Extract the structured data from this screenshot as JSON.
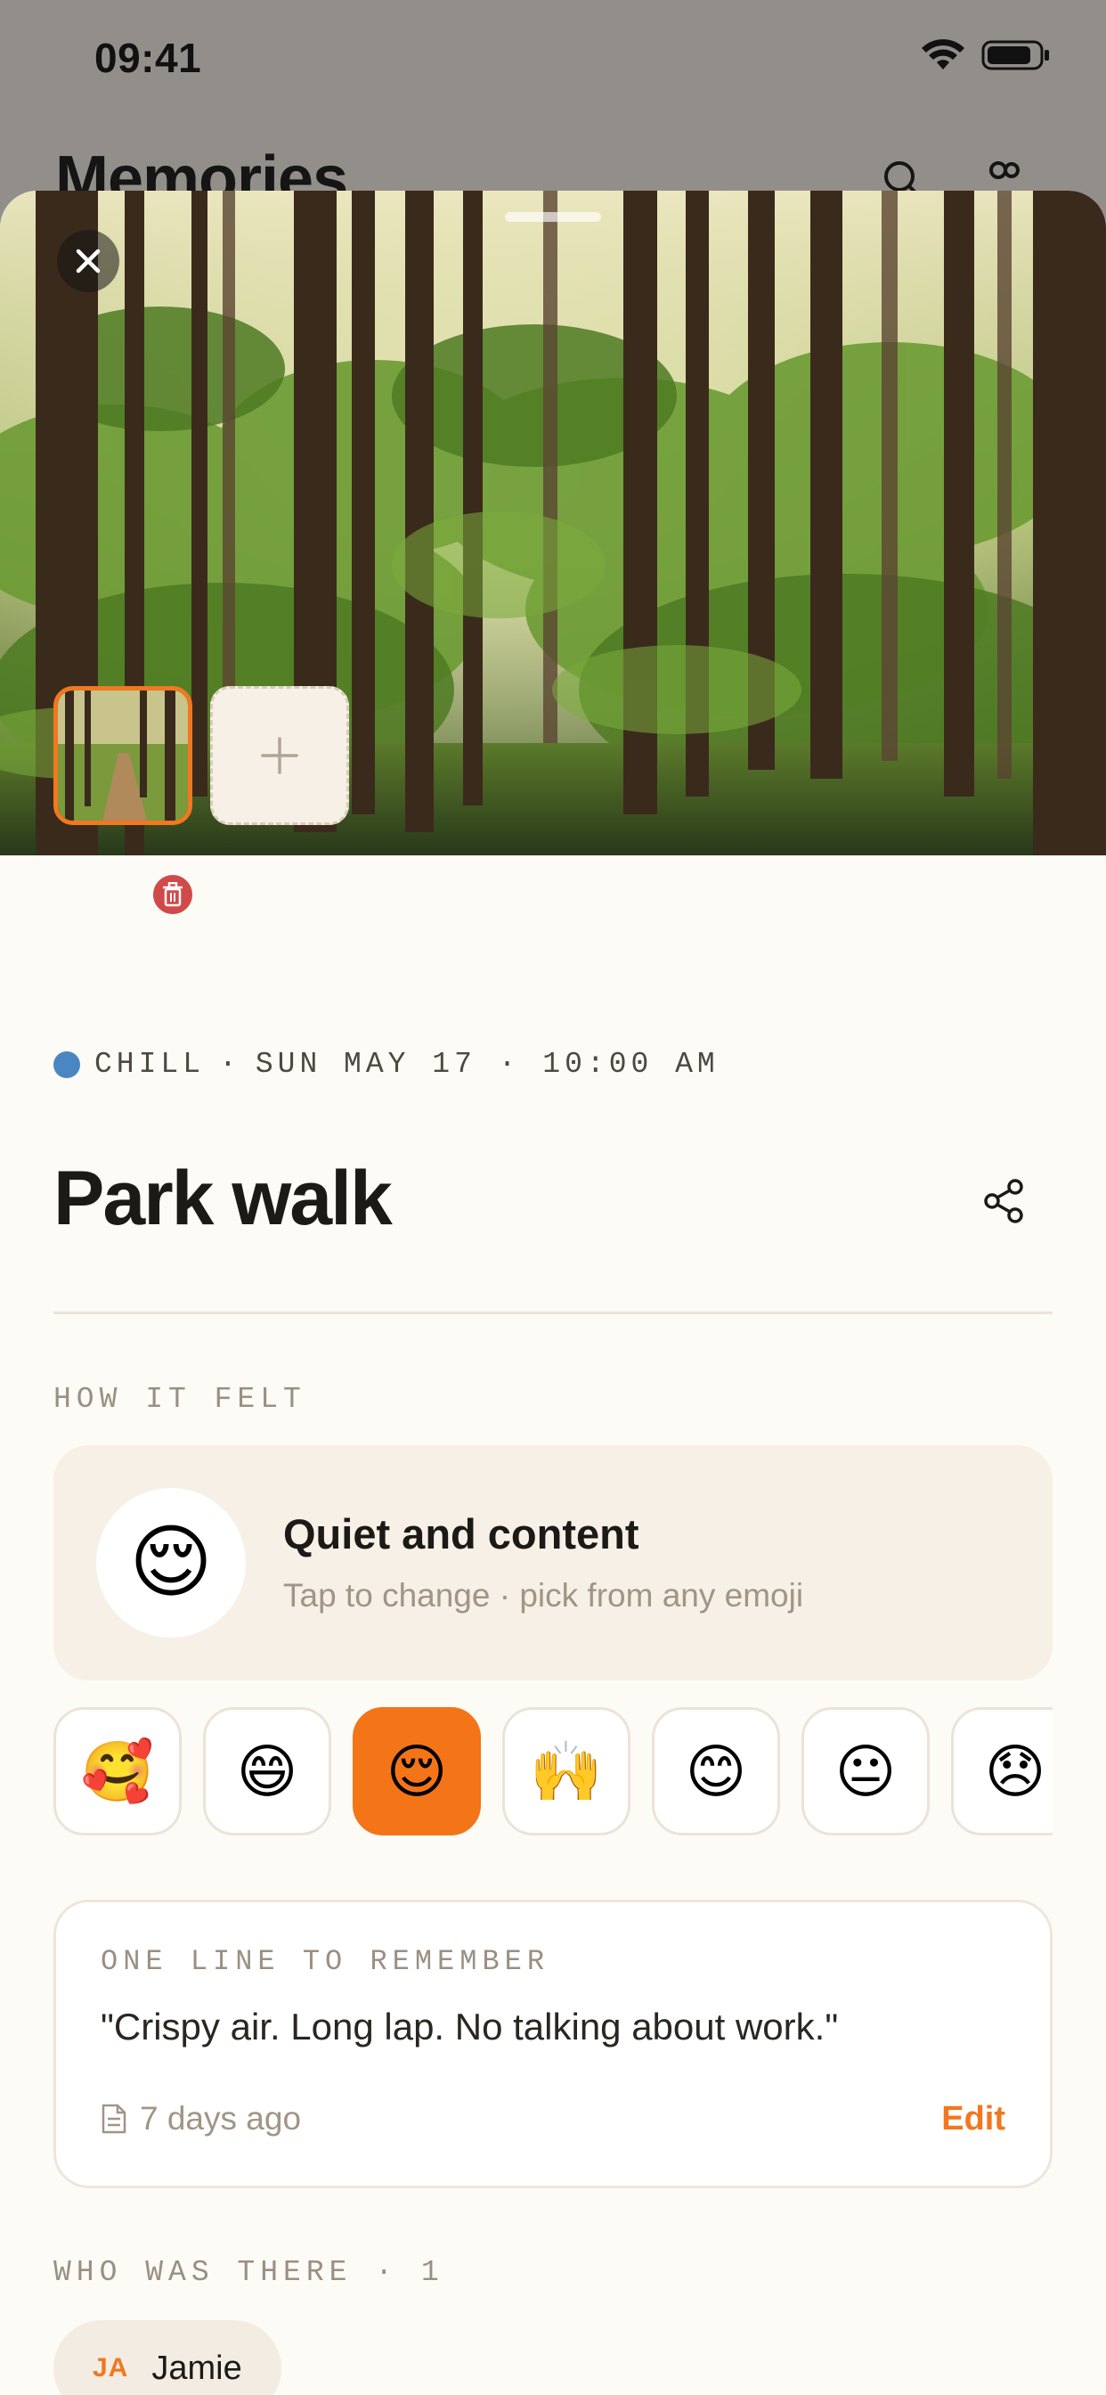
{
  "status_bar": {
    "time": "09:41"
  },
  "background": {
    "title": "Memories"
  },
  "memory": {
    "mood_tag": "CHILL",
    "date_time": "SUN MAY 17 · 10:00 AM",
    "title": "Park walk",
    "mood_color": "#4a86c2"
  },
  "how_it_felt": {
    "label": "HOW IT FELT",
    "emoji": "😌",
    "title": "Quiet and content",
    "subtitle": "Tap to change · pick from any emoji",
    "options": [
      "🥰",
      "😄",
      "😌",
      "🙌",
      "😊",
      "😐",
      "😞"
    ],
    "selected_index": 2
  },
  "one_line": {
    "label": "ONE LINE TO REMEMBER",
    "quote": "\"Crispy air. Long lap. No talking about work.\"",
    "timestamp": "7 days ago",
    "edit_label": "Edit"
  },
  "who_was_there": {
    "label": "WHO WAS THERE · 1",
    "people": [
      {
        "initials": "JA",
        "name": "Jamie"
      }
    ]
  },
  "colors": {
    "accent": "#f07820",
    "delete": "#d04a4a",
    "background": "#fdfbf6"
  },
  "icons": [
    "close-icon",
    "trash-icon",
    "plus-icon",
    "share-icon",
    "note-icon",
    "wifi-icon",
    "battery-icon",
    "search-icon",
    "people-icon"
  ]
}
